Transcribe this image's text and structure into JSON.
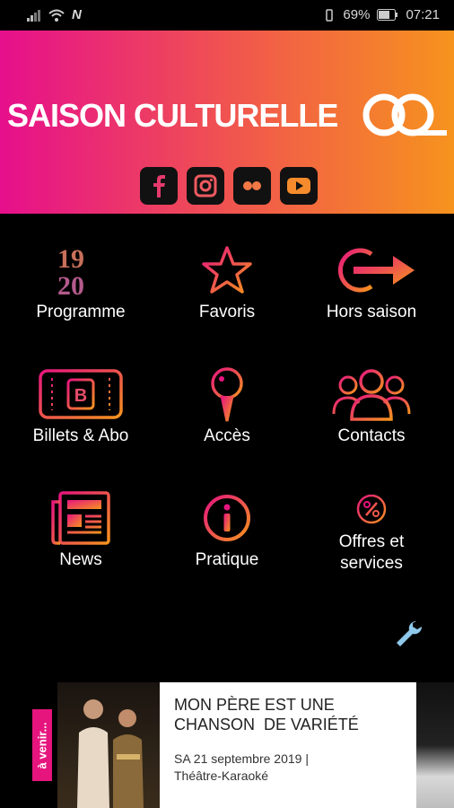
{
  "status_bar": {
    "battery": "69%",
    "time": "07:21",
    "carrier_letter": "N"
  },
  "header": {
    "logo_text": "SAISON CULTURELLE",
    "socials": [
      {
        "icon": "facebook-icon"
      },
      {
        "icon": "instagram-icon"
      },
      {
        "icon": "flickr-icon"
      },
      {
        "icon": "youtube-icon"
      }
    ]
  },
  "menu": [
    {
      "label": "Programme",
      "icon": "calendar-1920-icon",
      "top_text": "19",
      "bottom_text": "20"
    },
    {
      "label": "Favoris",
      "icon": "star-icon"
    },
    {
      "label": "Hors saison",
      "icon": "exit-arrow-icon"
    },
    {
      "label": "Billets & Abo",
      "icon": "ticket-icon",
      "badge_letter": "B"
    },
    {
      "label": "Accès",
      "icon": "map-pin-icon"
    },
    {
      "label": "Contacts",
      "icon": "people-icon"
    },
    {
      "label": "News",
      "icon": "newspaper-icon"
    },
    {
      "label": "Pratique",
      "icon": "info-icon"
    },
    {
      "label": "Offres et services",
      "label_line1": "Offres et",
      "label_line2": "services",
      "icon": "percent-icon"
    }
  ],
  "banner": {
    "tag": "à venir...",
    "event_title_line1": "MON PÈRE EST UNE",
    "event_title_line2": "CHANSON  DE VARIÉTÉ",
    "event_date": "SA 21 septembre 2019 |",
    "event_category": "Théâtre-Karaoké"
  },
  "colors": {
    "accent_pink": "#e60f8c",
    "accent_orange": "#f6931e",
    "background": "#000000"
  }
}
